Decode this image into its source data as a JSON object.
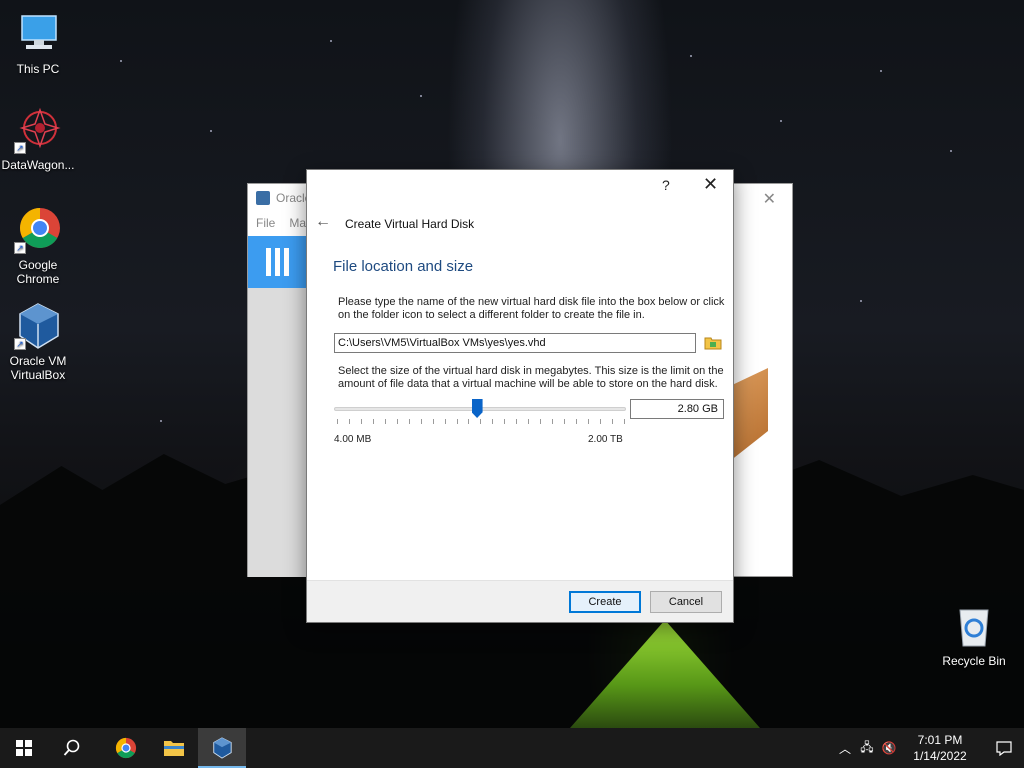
{
  "desktop": {
    "icons": [
      {
        "label": "This PC"
      },
      {
        "label": "DataWagon..."
      },
      {
        "label": "Google Chrome"
      },
      {
        "label": "Oracle VM VirtualBox"
      },
      {
        "label": "Recycle Bin"
      }
    ]
  },
  "background_window": {
    "title": "Oracle",
    "menu": [
      "File",
      "Ma"
    ]
  },
  "dialog": {
    "help_label": "?",
    "close_label": "✕",
    "back_label": "←",
    "title": "Create Virtual Hard Disk",
    "heading": "File location and size",
    "location_description": "Please type the name of the new virtual hard disk file into the box below or click on the folder icon to select a different folder to create the file in.",
    "file_path": "C:\\Users\\VM5\\VirtualBox VMs\\yes\\yes.vhd",
    "size_description": "Select the size of the virtual hard disk in megabytes. This size is the limit on the amount of file data that a virtual machine will be able to store on the hard disk.",
    "size_value": "2.80 GB",
    "slider_fraction": 0.49,
    "range_min": "4.00 MB",
    "range_max": "2.00 TB",
    "create_label": "Create",
    "cancel_label": "Cancel"
  },
  "taskbar": {
    "time": "7:01 PM",
    "date": "1/14/2022"
  },
  "colors": {
    "accent": "#0078d7",
    "heading": "#1e4a80",
    "slider_thumb": "#0a64c8"
  }
}
